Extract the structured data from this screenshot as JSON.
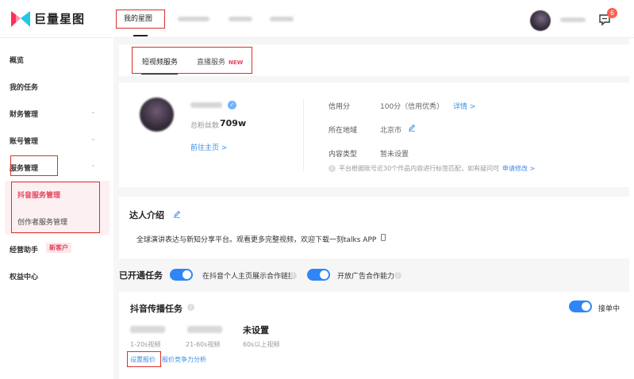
{
  "header": {
    "logo_text": "巨量星图",
    "nav_active": "我的星图",
    "msg_badge": "6"
  },
  "sidebar": {
    "items": [
      {
        "label": "概览"
      },
      {
        "label": "我的任务"
      },
      {
        "label": "财务管理"
      },
      {
        "label": "账号管理"
      },
      {
        "label": "服务管理"
      },
      {
        "label": "经营助手"
      },
      {
        "label": "权益中心"
      }
    ],
    "sub_items": [
      {
        "label": "抖音服务管理"
      },
      {
        "label": "创作者服务管理"
      }
    ],
    "new_client_badge": "新客户"
  },
  "tabs": {
    "short_video": "短视频服务",
    "live": "直播服务",
    "live_badge": "NEW"
  },
  "profile": {
    "fans_label": "总粉丝数",
    "fans_value": "709w",
    "home_link": "前往主页 >",
    "credit_label": "信用分",
    "credit_value": "100分（信用优秀）",
    "credit_link": "详情 >",
    "region_label": "所在地域",
    "region_value": "北京市",
    "type_label": "内容类型",
    "type_value": "暂未设置",
    "tip": "平台根据账号近30个作品内容进行标签匹配，如有疑问可",
    "tip_link": "申请修改 >"
  },
  "intro": {
    "title": "达人介绍",
    "text": "全球演讲表达与新知分享平台。观看更多完整视频，欢迎下载一刻talks APP"
  },
  "tasks": {
    "title": "已开通任务",
    "toggle1_label": "在抖音个人主页展示合作链接",
    "toggle2_label": "开放广告合作能力"
  },
  "spread": {
    "title": "抖音传播任务",
    "status_label": "接单中",
    "price1_label": "1-20s视频",
    "price2_label": "21-60s视频",
    "price3_value": "未设置",
    "price3_label": "60s以上视频",
    "set_price_link": "设置报价",
    "analysis_link": "报价竞争力分析"
  },
  "colors": {
    "accent_blue": "#2f86f6",
    "brand_pink": "#e2445c",
    "highlight_red": "#d9302b"
  }
}
